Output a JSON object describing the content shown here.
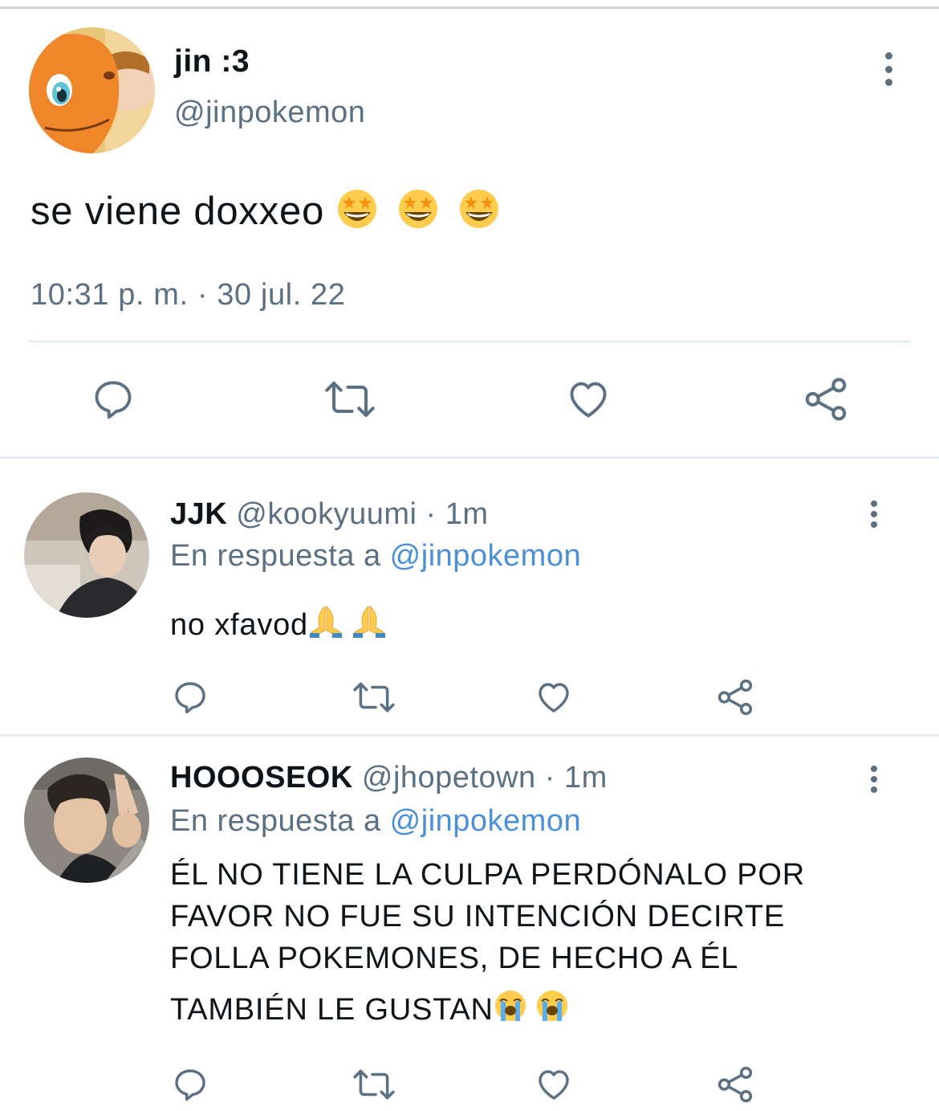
{
  "main_tweet": {
    "display_name": "jin :3",
    "handle": "@jinpokemon",
    "text": "se viene doxxeo",
    "emojis": [
      "star-struck-emoji",
      "star-struck-emoji",
      "star-struck-emoji"
    ],
    "timestamp": "10:31 p. m. · 30 jul. 22",
    "actions": [
      "reply-icon",
      "retweet-icon",
      "like-icon",
      "share-icon"
    ]
  },
  "replies": [
    {
      "display_name": "JJK",
      "handle": "@kookyuumi",
      "separator": " · ",
      "time": "1m",
      "replying_prefix": "En respuesta a ",
      "replying_to": "@jinpokemon",
      "text": "no xfavod",
      "emojis": [
        "folded-hands-emoji",
        "folded-hands-emoji"
      ]
    },
    {
      "display_name": "HOOOSEOK",
      "handle": "@jhopetown",
      "separator": " · ",
      "time": "1m",
      "replying_prefix": "En respuesta a ",
      "replying_to": "@jinpokemon",
      "text_lines": [
        "ÉL NO TIENE LA CULPA PERDÓNALO POR",
        "FAVOR NO FUE SU INTENCIÓN DECIRTE",
        "FOLLA POKEMONES, DE HECHO A ÉL",
        "TAMBIÉN LE GUSTAN"
      ],
      "emojis": [
        "loudly-crying-emoji",
        "loudly-crying-emoji"
      ]
    }
  ],
  "colors": {
    "text": "#0f1419",
    "secondary": "#5b7083",
    "link": "#4a90d9",
    "divider": "#e1e8ed"
  }
}
